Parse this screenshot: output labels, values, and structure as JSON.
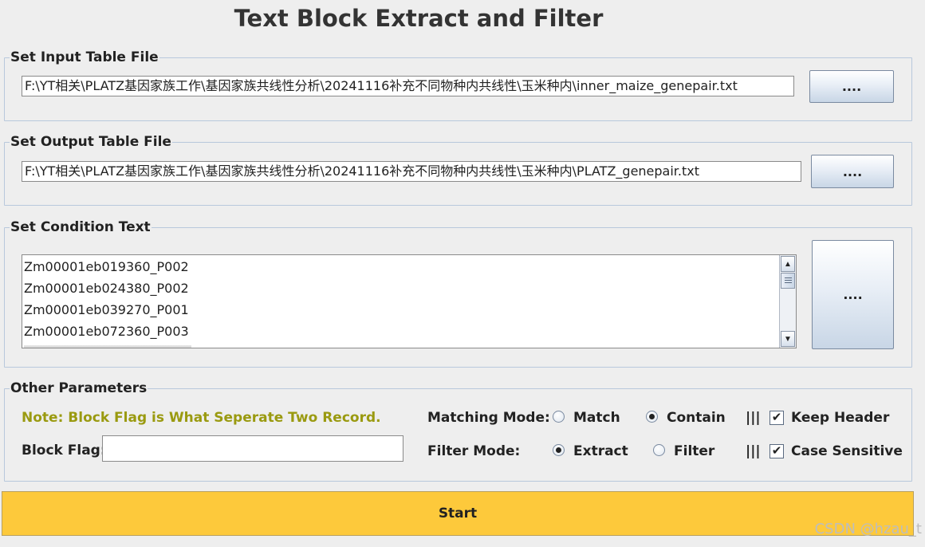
{
  "app": {
    "title": "Text Block Extract and Filter"
  },
  "input_section": {
    "legend": "Set Input Table File",
    "path": "F:\\YT相关\\PLATZ基因家族工作\\基因家族共线性分析\\20241116补充不同物种内共线性\\玉米种内\\inner_maize_genepair.txt",
    "browse_label": "...."
  },
  "output_section": {
    "legend": "Set Output Table File",
    "path": "F:\\YT相关\\PLATZ基因家族工作\\基因家族共线性分析\\20241116补充不同物种内共线性\\玉米种内\\PLATZ_genepair.txt",
    "browse_label": "...."
  },
  "condition_section": {
    "legend": "Set Condition Text",
    "lines": [
      "Zm00001eb019360_P002",
      "Zm00001eb024380_P002",
      "Zm00001eb039270_P001",
      "Zm00001eb072360_P003"
    ],
    "browse_label": "...."
  },
  "params_section": {
    "legend": "Other Parameters",
    "note": "Note: Block Flag is What Seperate Two Record.",
    "block_flag_label": "Block Flag:",
    "block_flag_value": "",
    "matching_mode_label": "Matching Mode:",
    "matching_options": {
      "match": "Match",
      "contain": "Contain",
      "selected": "Contain"
    },
    "filter_mode_label": "Filter Mode:",
    "filter_options": {
      "extract": "Extract",
      "filter": "Filter",
      "selected": "Extract"
    },
    "separator": "|||",
    "keep_header": {
      "label": "Keep Header",
      "checked": true
    },
    "case_sensitive": {
      "label": "Case Sensitive",
      "checked": true
    }
  },
  "start_label": "Start",
  "watermark": "CSDN @hzau_t",
  "colors": {
    "start_button": "#fdc93b",
    "note_text": "#9a9a10",
    "border": "#b8c8dc"
  }
}
